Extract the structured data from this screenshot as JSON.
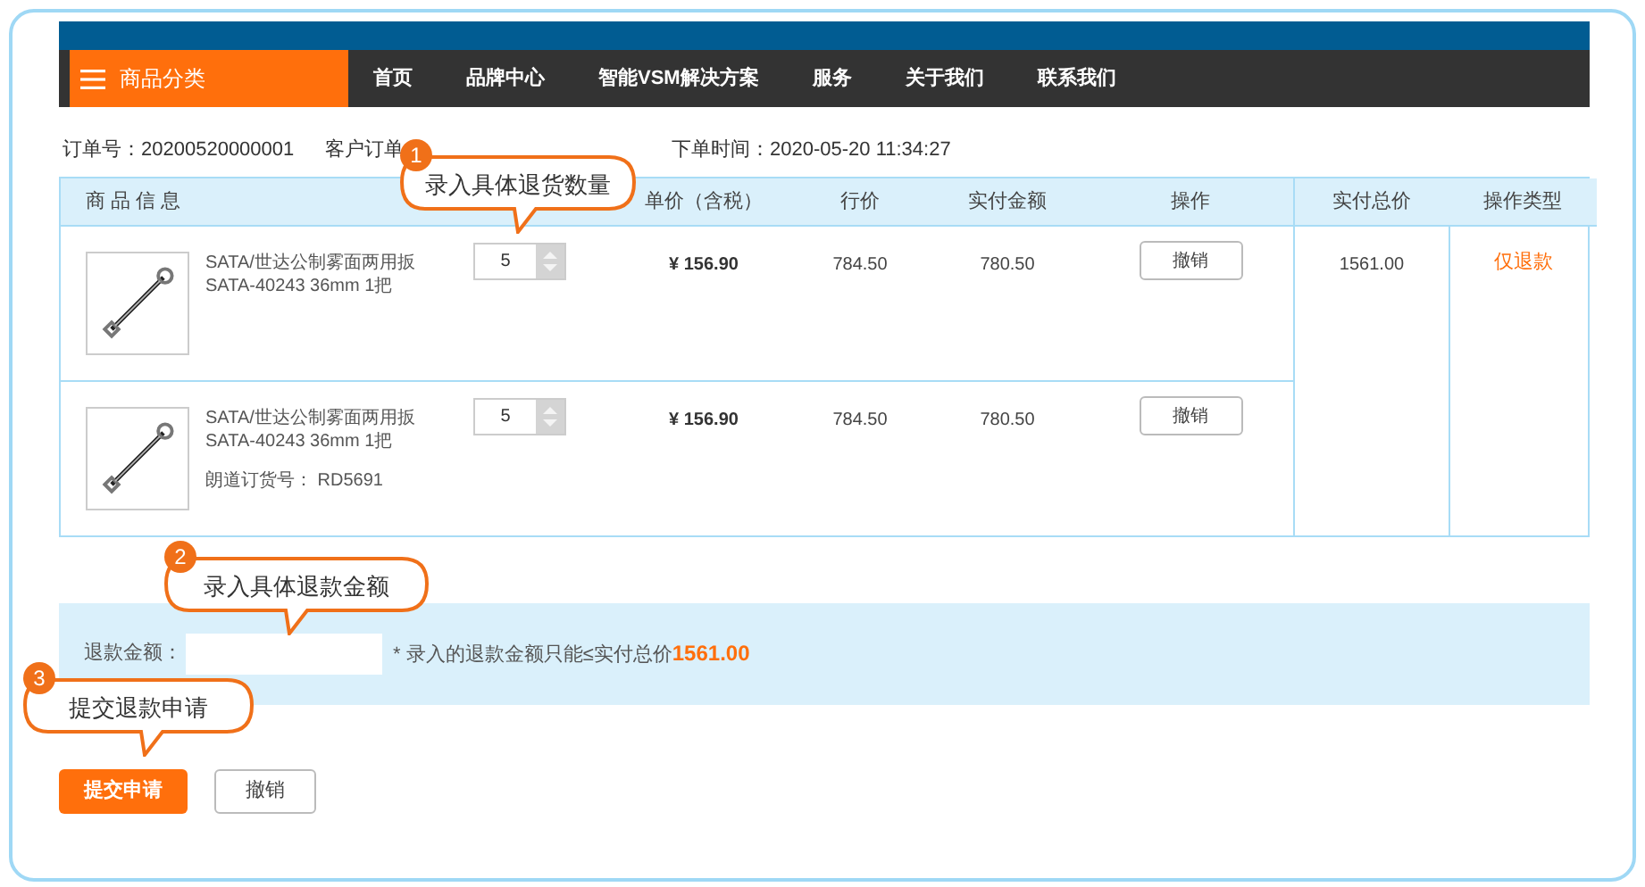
{
  "nav": {
    "category_button": "商品分类",
    "items": [
      {
        "label": "首页"
      },
      {
        "label": "品牌中心"
      },
      {
        "label": "智能VSM解决方案"
      },
      {
        "label": "服务"
      },
      {
        "label": "关于我们"
      },
      {
        "label": "联系我们"
      }
    ]
  },
  "order_info": {
    "order_no": "订单号：20200520000001",
    "customer_order": "客户订单",
    "order_time": "下单时间：2020-05-20 11:34:27"
  },
  "table": {
    "columns": [
      "商 品 信 息",
      "",
      "单价（含税）",
      "行价",
      "实付金额",
      "操作",
      "实付总价",
      "操作类型"
    ],
    "rows": [
      {
        "name_line1": "SATA/世达公制雾面两用扳",
        "name_line2": "SATA-40243 36mm 1把",
        "quantity": "5",
        "unit_price": "¥ 156.90",
        "line_price": "784.50",
        "paid_amount": "780.50",
        "action": "撤销"
      },
      {
        "name_line1": "SATA/世达公制雾面两用扳",
        "name_line2": "SATA-40243 36mm 1把",
        "order_code": "朗道订货号： RD5691",
        "quantity": "5",
        "unit_price": "¥ 156.90",
        "line_price": "784.50",
        "paid_amount": "780.50",
        "action": "撤销"
      }
    ],
    "total_paid": "1561.00",
    "operation_type": "仅退款"
  },
  "refund": {
    "label": "退款金额：",
    "note": "* 录入的退款金额只能≤实付总价",
    "note_amount": "1561.00"
  },
  "buttons": [
    {
      "label": "提交申请",
      "kind": "primary"
    },
    {
      "label": "撤销",
      "kind": "secondary"
    }
  ],
  "callouts": [
    {
      "number": "1",
      "text": "录入具体退货数量"
    },
    {
      "number": "2",
      "text": "录入具体退款金额"
    },
    {
      "number": "3",
      "text": "提交退款申请"
    }
  ]
}
